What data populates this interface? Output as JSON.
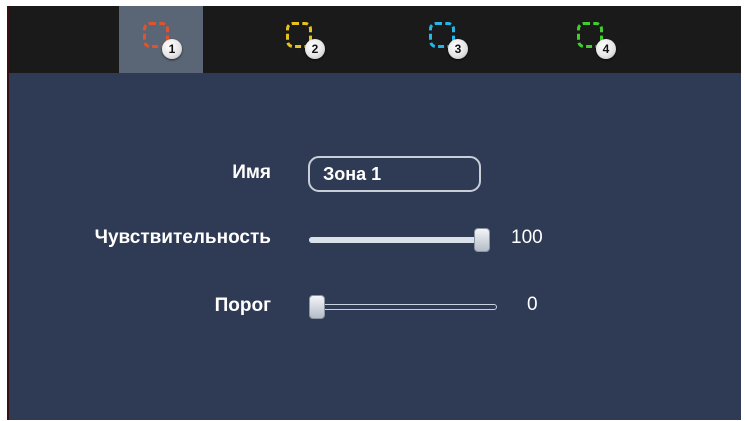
{
  "zones": [
    {
      "number": "1",
      "color": "#e0532b",
      "selected": true
    },
    {
      "number": "2",
      "color": "#e5c21e",
      "selected": false
    },
    {
      "number": "3",
      "color": "#23b6e6",
      "selected": false
    },
    {
      "number": "4",
      "color": "#3fcf2b",
      "selected": false
    }
  ],
  "form": {
    "name_label": "Имя",
    "name_value": "Зона 1",
    "sensitivity_label": "Чувствительность",
    "sensitivity_value": "100",
    "sensitivity_level": 100,
    "threshold_label": "Порог",
    "threshold_value": "0",
    "threshold_level": 0
  }
}
